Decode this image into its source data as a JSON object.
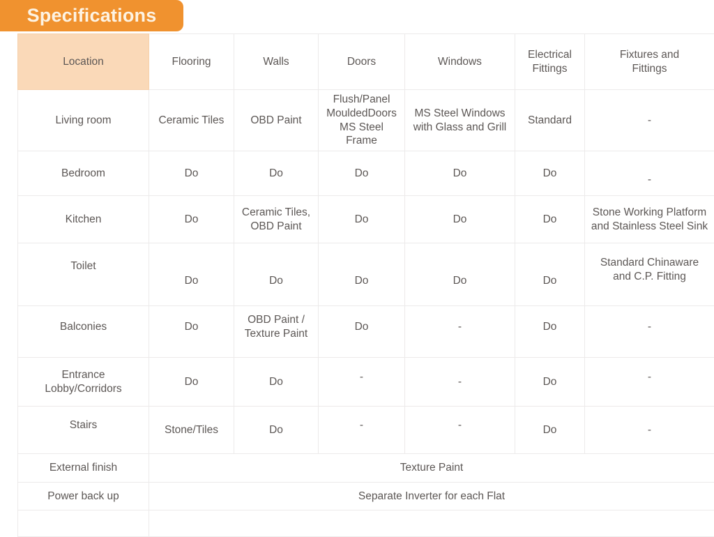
{
  "title": {
    "label": "Specifications"
  },
  "colors": {
    "accent_orange": "#f0922f",
    "title_text": "#fdf3e3",
    "header_location_bg": "#fad9b8",
    "header_bg": "#fbe6d2",
    "location_column_bg": "#fdeadb",
    "body_bg": "#ffffff",
    "grid_line": "#eceaea",
    "text": "#5c5755"
  },
  "table": {
    "columns": [
      "Location",
      "Flooring",
      "Walls",
      "Doors",
      "Windows",
      "Electrical Fittings",
      "Fixtures and Fittings"
    ],
    "headers": {
      "location": "Location",
      "flooring": "Flooring",
      "walls": "Walls",
      "doors": "Doors",
      "windows": "Windows",
      "electrical_line1": "Electrical",
      "electrical_line2": "Fittings",
      "fixtures_line1": "Fixtures and",
      "fixtures_line2": "Fittings"
    },
    "rows": [
      {
        "location": "Living room",
        "flooring": "Ceramic Tiles",
        "walls": "OBD Paint",
        "doors_line1": "Flush/Panel",
        "doors_line2": "MouldedDoors",
        "doors_line3": "MS Steel Frame",
        "windows_line1": "MS Steel Windows",
        "windows_line2": "with Glass and Grill",
        "electrical": "Standard",
        "fixtures": "-"
      },
      {
        "location": "Bedroom",
        "flooring": "Do",
        "walls": "Do",
        "doors": "Do",
        "windows": "Do",
        "electrical": "Do",
        "fixtures": "-"
      },
      {
        "location": "Kitchen",
        "flooring": "Do",
        "walls_line1": "Ceramic Tiles,",
        "walls_line2": "OBD Paint",
        "doors": "Do",
        "windows": "Do",
        "electrical": "Do",
        "fixtures_line1": "Stone Working Platform",
        "fixtures_line2": "and Stainless Steel Sink"
      },
      {
        "location": "Toilet",
        "flooring": "Do",
        "walls": "Do",
        "doors": "Do",
        "windows": "Do",
        "electrical": "Do",
        "fixtures_line1": "Standard Chinaware",
        "fixtures_line2": "and C.P. Fitting"
      },
      {
        "location": "Balconies",
        "flooring": "Do",
        "walls_line1": "OBD Paint /",
        "walls_line2": "Texture Paint",
        "doors": "Do",
        "windows": "-",
        "electrical": "Do",
        "fixtures": "-"
      },
      {
        "location_line1": "Entrance",
        "location_line2": "Lobby/Corridors",
        "flooring": "Do",
        "walls": "Do",
        "doors": "-",
        "windows": "-",
        "electrical": "Do",
        "fixtures": "-"
      },
      {
        "location": "Stairs",
        "flooring": "Stone/Tiles",
        "walls": "Do",
        "doors": "-",
        "windows": "-",
        "electrical": "Do",
        "fixtures": "-"
      },
      {
        "location": "External finish",
        "value": "Texture Paint"
      },
      {
        "location": "Power back up",
        "value": "Separate Inverter for each Flat"
      },
      {
        "location": "",
        "value": ""
      }
    ]
  }
}
